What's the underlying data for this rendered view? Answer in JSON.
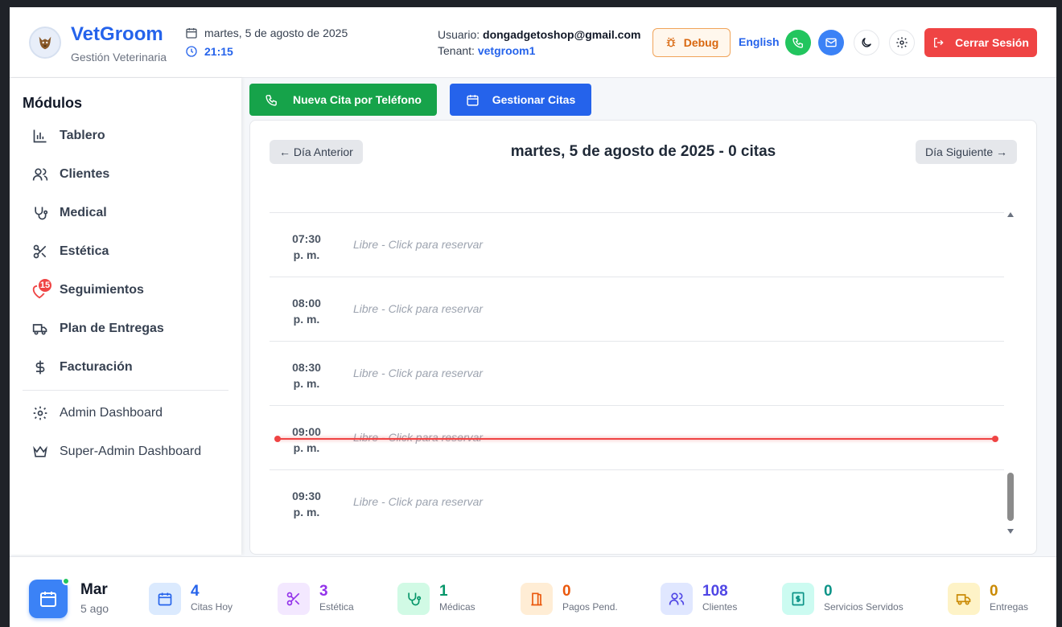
{
  "header": {
    "brand": "VetGroom",
    "brand_sub": "Gestión Veterinaria",
    "date": "martes, 5 de agosto de 2025",
    "time": "21:15",
    "user_label": "Usuario:",
    "user_email": "dongadgetoshop@gmail.com",
    "tenant_label": "Tenant:",
    "tenant": "vetgroom1",
    "debug_label": "Debug",
    "lang_label": "English",
    "logout_label": "Cerrar Sesión"
  },
  "sidebar": {
    "title": "Módulos",
    "items": [
      {
        "label": "Tablero",
        "icon": "bar-chart-icon"
      },
      {
        "label": "Clientes",
        "icon": "users-icon"
      },
      {
        "label": "Medical",
        "icon": "stethoscope-icon"
      },
      {
        "label": "Estética",
        "icon": "scissors-icon"
      },
      {
        "label": "Seguimientos",
        "icon": "heart-icon",
        "badge": "15"
      },
      {
        "label": "Plan de Entregas",
        "icon": "truck-icon"
      },
      {
        "label": "Facturación",
        "icon": "dollar-icon"
      }
    ],
    "admin_items": [
      {
        "label": "Admin Dashboard",
        "icon": "gear-icon"
      },
      {
        "label": "Super-Admin Dashboard",
        "icon": "crown-icon"
      }
    ]
  },
  "actions": {
    "new_phone_appt": "Nueva Cita por Teléfono",
    "manage_appts": "Gestionar Citas"
  },
  "schedule": {
    "prev_label": "← Día Anterior",
    "next_label": "Día Siguiente →",
    "title": "martes, 5 de agosto de 2025 - 0 citas",
    "slots": [
      {
        "time": "07:30",
        "period": "p. m.",
        "status": "Libre - Click para reservar"
      },
      {
        "time": "08:00",
        "period": "p. m.",
        "status": "Libre - Click para reservar"
      },
      {
        "time": "08:30",
        "period": "p. m.",
        "status": "Libre - Click para reservar"
      },
      {
        "time": "09:00",
        "period": "p. m.",
        "status": "Libre - Click para reservar"
      },
      {
        "time": "09:30",
        "period": "p. m.",
        "status": "Libre - Click para reservar"
      }
    ],
    "now_color": "#ef4444"
  },
  "footer": {
    "day_name": "Mar",
    "day_date": "5 ago",
    "stats": [
      {
        "value": "4",
        "label": "Citas Hoy",
        "icon": "calendar-icon",
        "color": "#2563eb",
        "bg": "#dbeafe"
      },
      {
        "value": "3",
        "label": "Estética",
        "icon": "scissors-icon",
        "color": "#9333ea",
        "bg": "#f3e8ff"
      },
      {
        "value": "1",
        "label": "Médicas",
        "icon": "stethoscope-icon",
        "color": "#059669",
        "bg": "#d1fae5"
      },
      {
        "value": "0",
        "label": "Pagos Pend.",
        "icon": "door-icon",
        "color": "#ea580c",
        "bg": "#ffedd5"
      },
      {
        "value": "108",
        "label": "Clientes",
        "icon": "users-icon",
        "color": "#4f46e5",
        "bg": "#e0e7ff"
      },
      {
        "value": "0",
        "label": "Servicios Servidos",
        "icon": "receipt-icon",
        "color": "#0d9488",
        "bg": "#ccfbf1"
      },
      {
        "value": "0",
        "label": "Entregas",
        "icon": "truck-icon",
        "color": "#ca8a04",
        "bg": "#fef3c7"
      }
    ]
  }
}
